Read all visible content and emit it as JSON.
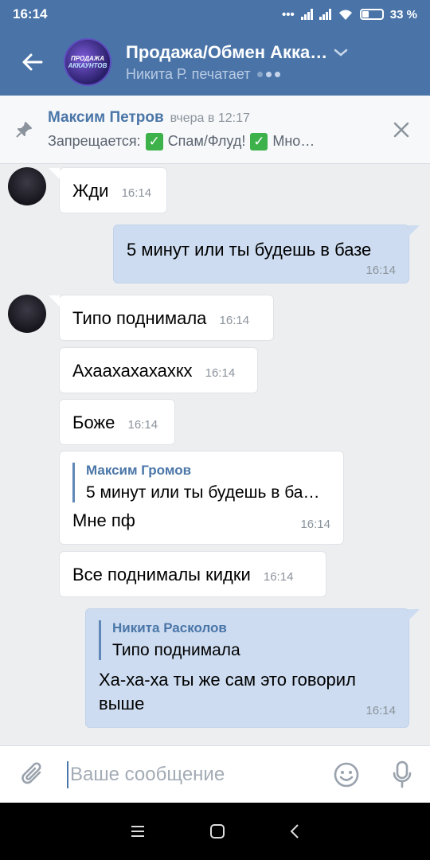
{
  "status": {
    "time": "16:14",
    "battery": "33 %"
  },
  "header": {
    "title": "Продажа/Обмен Акка…",
    "typing": "Никита Р. печатает",
    "logo_line1": "ПРОДАЖА",
    "logo_line2": "АККАУНТОВ"
  },
  "pinned": {
    "author": "Максим Петров",
    "time": "вчера в 12:17",
    "text_prefix": "Запрещается:",
    "item1": "Спам/Флуд!",
    "item2": "Мно…",
    "check_glyph": "✓"
  },
  "messages": [
    {
      "dir": "in",
      "text": "Жди",
      "time": "16:14"
    },
    {
      "dir": "out",
      "text": "5 минут или ты будешь в базе",
      "time": "16:14"
    },
    {
      "dir": "in",
      "text": "Типо поднимала",
      "time": "16:14"
    },
    {
      "dir": "in",
      "text": "Ахаахахахахкх",
      "time": "16:14"
    },
    {
      "dir": "in",
      "text": "Боже",
      "time": "16:14"
    },
    {
      "dir": "in",
      "reply_name": "Максим Громов",
      "reply_text": "5 минут или ты будешь в ба…",
      "text": "Мне пф",
      "time": "16:14"
    },
    {
      "dir": "in",
      "text": "Все поднималы кидки",
      "time": "16:14"
    },
    {
      "dir": "out",
      "reply_name": "Никита Расколов",
      "reply_text": "Типо поднимала",
      "text": "Ха-ха-ха ты же сам это говорил выше",
      "time": "16:14"
    }
  ],
  "input": {
    "placeholder": "Ваше сообщение"
  },
  "colors": {
    "header": "#4a74a8",
    "accent": "#4a76a8",
    "outgoing": "#cddcf0",
    "background": "#edeef0"
  }
}
